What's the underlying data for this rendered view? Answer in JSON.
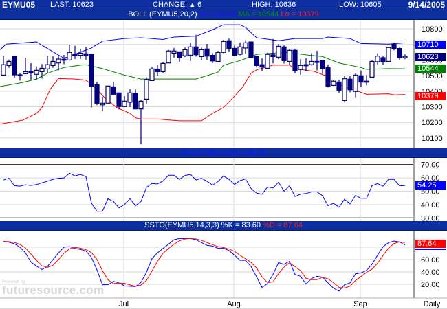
{
  "header": {
    "symbol": "EYMU05",
    "last": "LAST: 10623",
    "change_label": "CHANGE:",
    "change_icon": "triangle-up",
    "change_value": "6",
    "high": "HIGH: 10636",
    "low": "LOW: 10605",
    "date": "9/14/2005"
  },
  "boll_title": {
    "main": "BOLL (EYMU5,20,2)",
    "hi": "Hi = 10710",
    "ma": "MA = 10544",
    "lo": "Lo = 10379"
  },
  "rsi_title": "RSI (EYMU5,14) = 54.25",
  "ssto_title": {
    "main": "SSTO(EYMU5,14,3,3) %K = 83.60",
    "d": "%D = 87.64"
  },
  "badges": {
    "hi": "10710",
    "last": "10623",
    "ma": "10544",
    "lo": "10379",
    "rsi": "54.25",
    "d": "87.64"
  },
  "x_axis": {
    "months": [
      {
        "label": "Jul",
        "index": 22
      },
      {
        "label": "Aug",
        "index": 42
      },
      {
        "label": "Sep",
        "index": 65
      }
    ],
    "period": "Daily"
  },
  "watermark": {
    "powered": "Powered by",
    "brand": "futuresource.com"
  },
  "colors": {
    "bar": "#0d2f9f",
    "candle": "#000080",
    "upper": "#0000ff",
    "ma": "#008000",
    "lower": "#ff0000",
    "k": "#0000ff",
    "d": "#ff0000"
  },
  "chart_data": [
    {
      "type": "candlestick",
      "title": "BOLL (EYMU5,20,2)",
      "y_ticks": [
        10800,
        10700,
        10600,
        10500,
        10400,
        10300,
        10200,
        10100
      ],
      "ylim": [
        10040,
        10860
      ],
      "ohlc": [
        [
          10503,
          10628,
          10503,
          10570
        ],
        [
          10565,
          10603,
          10550,
          10591
        ],
        [
          10624,
          10624,
          10486,
          10505
        ],
        [
          10505,
          10518,
          10468,
          10499
        ],
        [
          10512,
          10615,
          10512,
          10525
        ],
        [
          10525,
          10580,
          10474,
          10517
        ],
        [
          10508,
          10559,
          10474,
          10534
        ],
        [
          10525,
          10574,
          10481,
          10547
        ],
        [
          10543,
          10628,
          10518,
          10570
        ],
        [
          10565,
          10625,
          10550,
          10591
        ],
        [
          10581,
          10628,
          10533,
          10606
        ],
        [
          10605,
          10633,
          10574,
          10599
        ],
        [
          10600,
          10699,
          10596,
          10649
        ],
        [
          10637,
          10691,
          10606,
          10630
        ],
        [
          10630,
          10669,
          10606,
          10644
        ],
        [
          10640,
          10684,
          10603,
          10631
        ],
        [
          10638,
          10638,
          10295,
          10431
        ],
        [
          10442,
          10459,
          10310,
          10321
        ],
        [
          10312,
          10364,
          10273,
          10323
        ],
        [
          10323,
          10433,
          10323,
          10433
        ],
        [
          10428,
          10459,
          10373,
          10380
        ],
        [
          10389,
          10389,
          10283,
          10301
        ],
        [
          10301,
          10368,
          10301,
          10336
        ],
        [
          10329,
          10412,
          10298,
          10389
        ],
        [
          10386,
          10412,
          10286,
          10286
        ],
        [
          10286,
          10346,
          10060,
          10336
        ],
        [
          10349,
          10489,
          10321,
          10474
        ],
        [
          10468,
          10555,
          10468,
          10543
        ],
        [
          10540,
          10567,
          10500,
          10525
        ],
        [
          10525,
          10589,
          10518,
          10578
        ],
        [
          10581,
          10665,
          10581,
          10658
        ],
        [
          10644,
          10677,
          10614,
          10658
        ],
        [
          10653,
          10653,
          10589,
          10614
        ],
        [
          10627,
          10680,
          10618,
          10666
        ],
        [
          10631,
          10710,
          10594,
          10684
        ],
        [
          10684,
          10762,
          10622,
          10634
        ],
        [
          10622,
          10680,
          10600,
          10666
        ],
        [
          10671,
          10703,
          10600,
          10625
        ],
        [
          10630,
          10644,
          10580,
          10594
        ],
        [
          10591,
          10659,
          10591,
          10649
        ],
        [
          10649,
          10730,
          10644,
          10719
        ],
        [
          10724,
          10737,
          10653,
          10675
        ],
        [
          10675,
          10693,
          10625,
          10630
        ],
        [
          10637,
          10712,
          10630,
          10684
        ],
        [
          10677,
          10727,
          10640,
          10710
        ],
        [
          10716,
          10716,
          10614,
          10614
        ],
        [
          10625,
          10625,
          10552,
          10565
        ],
        [
          10570,
          10611,
          10530,
          10555
        ],
        [
          10547,
          10647,
          10547,
          10636
        ],
        [
          10633,
          10735,
          10578,
          10622
        ],
        [
          10618,
          10703,
          10606,
          10688
        ],
        [
          10684,
          10694,
          10578,
          10596
        ],
        [
          10591,
          10671,
          10567,
          10662
        ],
        [
          10662,
          10671,
          10515,
          10530
        ],
        [
          10539,
          10606,
          10506,
          10565
        ],
        [
          10570,
          10611,
          10527,
          10564
        ],
        [
          10570,
          10644,
          10564,
          10591
        ],
        [
          10591,
          10659,
          10533,
          10585
        ],
        [
          10597,
          10597,
          10512,
          10547
        ],
        [
          10552,
          10571,
          10424,
          10433
        ],
        [
          10437,
          10474,
          10433,
          10464
        ],
        [
          10459,
          10474,
          10390,
          10405
        ],
        [
          10340,
          10496,
          10327,
          10480
        ],
        [
          10477,
          10496,
          10393,
          10409
        ],
        [
          10398,
          10515,
          10361,
          10503
        ],
        [
          10499,
          10533,
          10427,
          10458
        ],
        [
          10464,
          10503,
          10437,
          10458
        ],
        [
          10490,
          10597,
          10486,
          10591
        ],
        [
          10589,
          10643,
          10571,
          10625
        ],
        [
          10615,
          10625,
          10570,
          10590
        ],
        [
          10591,
          10680,
          10591,
          10680
        ],
        [
          10700,
          10710,
          10662,
          10674
        ],
        [
          10674,
          10680,
          10600,
          10615
        ],
        [
          10615,
          10636,
          10605,
          10623
        ]
      ],
      "upper": [
        [
          -0.6,
          10666
        ],
        [
          0.5,
          10702
        ],
        [
          6,
          10716
        ],
        [
          11,
          10611
        ],
        [
          16,
          10677
        ],
        [
          18,
          10721
        ],
        [
          22,
          10738
        ],
        [
          25,
          10743
        ],
        [
          29,
          10732
        ],
        [
          31,
          10747
        ],
        [
          35,
          10753
        ],
        [
          38,
          10794
        ],
        [
          40,
          10826
        ],
        [
          43,
          10826
        ],
        [
          44,
          10809
        ],
        [
          46,
          10743
        ],
        [
          50,
          10724
        ],
        [
          53,
          10738
        ],
        [
          58,
          10738
        ],
        [
          59,
          10747
        ],
        [
          63,
          10738
        ],
        [
          65,
          10706
        ],
        [
          70,
          10702
        ],
        [
          73,
          10710
        ]
      ],
      "ma": [
        [
          -0.6,
          10430
        ],
        [
          3.5,
          10456
        ],
        [
          6,
          10478
        ],
        [
          8,
          10515
        ],
        [
          11,
          10552
        ],
        [
          14,
          10567
        ],
        [
          15,
          10570
        ],
        [
          18,
          10545
        ],
        [
          22,
          10503
        ],
        [
          24,
          10486
        ],
        [
          25,
          10478
        ],
        [
          35,
          10478
        ],
        [
          37,
          10500
        ],
        [
          39,
          10522
        ],
        [
          40,
          10567
        ],
        [
          43,
          10596
        ],
        [
          46,
          10636
        ],
        [
          49,
          10644
        ],
        [
          52,
          10647
        ],
        [
          55,
          10633
        ],
        [
          58,
          10622
        ],
        [
          61,
          10581
        ],
        [
          65,
          10552
        ],
        [
          66,
          10540
        ],
        [
          70,
          10545
        ],
        [
          73,
          10544
        ]
      ],
      "lower": [
        [
          -0.6,
          10189
        ],
        [
          3.5,
          10214
        ],
        [
          6,
          10258
        ],
        [
          7,
          10295
        ],
        [
          8.5,
          10412
        ],
        [
          10,
          10481
        ],
        [
          13,
          10478
        ],
        [
          15,
          10471
        ],
        [
          17,
          10412
        ],
        [
          18.5,
          10354
        ],
        [
          20.6,
          10295
        ],
        [
          23,
          10258
        ],
        [
          24,
          10229
        ],
        [
          25,
          10221
        ],
        [
          28,
          10221
        ],
        [
          32,
          10210
        ],
        [
          36,
          10210
        ],
        [
          38,
          10258
        ],
        [
          40,
          10295
        ],
        [
          42,
          10368
        ],
        [
          43.5,
          10427
        ],
        [
          45,
          10515
        ],
        [
          46,
          10537
        ],
        [
          49,
          10567
        ],
        [
          52,
          10567
        ],
        [
          53,
          10545
        ],
        [
          56.5,
          10527
        ],
        [
          58.5,
          10500
        ],
        [
          60,
          10456
        ],
        [
          63.5,
          10412
        ],
        [
          66,
          10380
        ],
        [
          70,
          10383
        ],
        [
          71,
          10376
        ],
        [
          73,
          10379
        ]
      ]
    },
    {
      "type": "line",
      "title": "RSI (EYMU5,14)",
      "y_ticks": [
        70,
        60,
        50,
        40,
        30
      ],
      "ylim": [
        28,
        72
      ],
      "values": [
        58.4,
        59.7,
        54.1,
        53.8,
        54.8,
        54.3,
        55,
        56.3,
        57.5,
        58.9,
        59.7,
        60,
        63.5,
        61.5,
        62.6,
        60.9,
        41,
        35,
        35,
        44.4,
        42.3,
        37.5,
        40.1,
        44.4,
        39.2,
        42.3,
        52.9,
        55.8,
        55.5,
        57.7,
        62,
        62,
        58.9,
        61.8,
        62.6,
        58.5,
        59.7,
        57.5,
        54.6,
        57.2,
        61.5,
        58.9,
        55.1,
        58,
        59.2,
        52.1,
        48.6,
        47.8,
        53.2,
        52.4,
        56.8,
        50,
        54.1,
        46.1,
        47.8,
        48.3,
        49.5,
        49.5,
        46.6,
        39.2,
        41,
        38,
        44,
        40.6,
        46.9,
        44.7,
        44.7,
        54.1,
        55.8,
        53.8,
        58.9,
        58.9,
        54.1,
        54.25
      ]
    },
    {
      "type": "line",
      "title": "SSTO(EYMU5,14,3,3)",
      "y_ticks": [
        60,
        40,
        20
      ],
      "ylim": [
        0,
        100
      ],
      "series": [
        {
          "name": "%K",
          "values": [
            89.2,
            88,
            85.5,
            80,
            70.8,
            56,
            49.5,
            44,
            48.8,
            59.8,
            70.8,
            80,
            81,
            78,
            76.3,
            73.8,
            63.5,
            43.2,
            19.3,
            19.3,
            24.8,
            22.3,
            17.5,
            16.8,
            16.4,
            23,
            39.6,
            61.6,
            70.8,
            78,
            84.8,
            92.1,
            94,
            94,
            94,
            92.1,
            87.4,
            83,
            81.8,
            78.2,
            78.2,
            74.5,
            67.1,
            58.7,
            58.7,
            48.8,
            32.2,
            14.9,
            21.1,
            35.9,
            55,
            52.4,
            57.2,
            35.9,
            32.9,
            20.4,
            29.3,
            32.9,
            31.5,
            22.3,
            13.8,
            9,
            19.3,
            22.3,
            37,
            38.5,
            42.5,
            52.4,
            67.1,
            80.7,
            87.4,
            90,
            88.5,
            83.6
          ]
        },
        {
          "name": "%D",
          "values": [
            89.5,
            89,
            87.6,
            84.5,
            78.8,
            68.9,
            58.8,
            49.8,
            47.4,
            50.9,
            59.8,
            70.2,
            77.3,
            79.7,
            78.4,
            76,
            71.2,
            60.2,
            42,
            27.3,
            21.1,
            22.1,
            21.5,
            18.9,
            16.9,
            18.7,
            26.3,
            41.4,
            57.3,
            70.1,
            77.9,
            85,
            90.3,
            93.4,
            94,
            93.4,
            91.2,
            87.5,
            84.1,
            81,
            79.4,
            77,
            73.3,
            66.8,
            61.5,
            55.4,
            46.6,
            32,
            22.7,
            24,
            37.3,
            47.8,
            54.9,
            48.5,
            42,
            29.7,
            27.5,
            27.5,
            31.2,
            28.9,
            22.5,
            15,
            14,
            16.9,
            26.2,
            32.6,
            39.3,
            44.5,
            54,
            66.7,
            78.4,
            86,
            88.6,
            87.64
          ]
        }
      ]
    }
  ]
}
